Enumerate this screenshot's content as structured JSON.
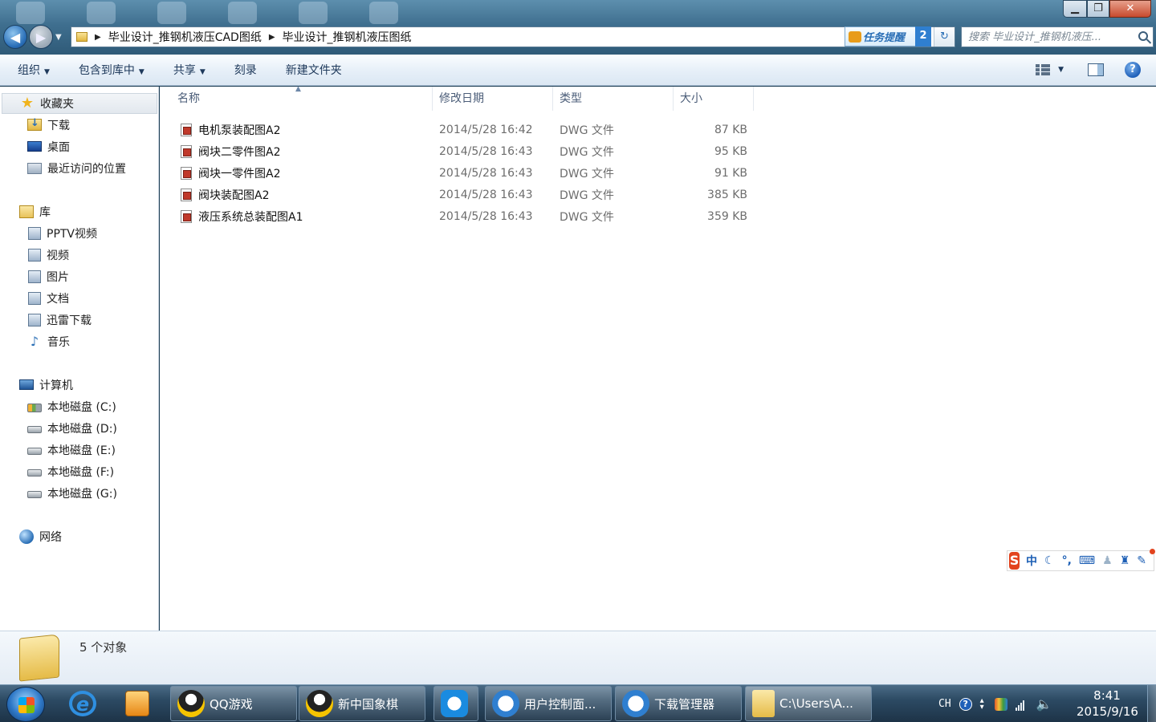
{
  "window": {
    "buttons": {
      "minimize": "▁",
      "maximize": "❐",
      "close": "✕"
    }
  },
  "address": {
    "crumbs": [
      "毕业设计_推钢机液压CAD图纸",
      "毕业设计_推钢机液压图纸"
    ],
    "task_reminder": {
      "label": "任务提醒",
      "count": "2"
    },
    "search_placeholder": "搜索 毕业设计_推钢机液压..."
  },
  "toolbar": {
    "organize": "组织",
    "include_library": "包含到库中",
    "share": "共享",
    "burn": "刻录",
    "new_folder": "新建文件夹"
  },
  "sidebar": {
    "favorites": {
      "label": "收藏夹",
      "items": [
        {
          "label": "下载",
          "icon": "download-folder-icon"
        },
        {
          "label": "桌面",
          "icon": "desktop-icon"
        },
        {
          "label": "最近访问的位置",
          "icon": "recent-places-icon"
        }
      ]
    },
    "libraries": {
      "label": "库",
      "items": [
        {
          "label": "PPTV视频",
          "icon": "library-icon"
        },
        {
          "label": "视频",
          "icon": "video-library-icon"
        },
        {
          "label": "图片",
          "icon": "pictures-library-icon"
        },
        {
          "label": "文档",
          "icon": "documents-library-icon"
        },
        {
          "label": "迅雷下载",
          "icon": "library-icon"
        },
        {
          "label": "音乐",
          "icon": "music-library-icon"
        }
      ]
    },
    "computer": {
      "label": "计算机",
      "items": [
        {
          "label": "本地磁盘 (C:)"
        },
        {
          "label": "本地磁盘 (D:)"
        },
        {
          "label": "本地磁盘 (E:)"
        },
        {
          "label": "本地磁盘 (F:)"
        },
        {
          "label": "本地磁盘 (G:)"
        }
      ]
    },
    "network": {
      "label": "网络"
    }
  },
  "files": {
    "headers": {
      "name": "名称",
      "date": "修改日期",
      "type": "类型",
      "size": "大小"
    },
    "rows": [
      {
        "name": "电机泵装配图A2",
        "date": "2014/5/28 16:42",
        "type": "DWG 文件",
        "size": "87 KB"
      },
      {
        "name": "阀块二零件图A2",
        "date": "2014/5/28 16:43",
        "type": "DWG 文件",
        "size": "95 KB"
      },
      {
        "name": "阀块一零件图A2",
        "date": "2014/5/28 16:43",
        "type": "DWG 文件",
        "size": "91 KB"
      },
      {
        "name": "阀块装配图A2",
        "date": "2014/5/28 16:43",
        "type": "DWG 文件",
        "size": "385 KB"
      },
      {
        "name": "液压系统总装配图A1",
        "date": "2014/5/28 16:43",
        "type": "DWG 文件",
        "size": "359 KB"
      }
    ]
  },
  "ime": {
    "logo": "S",
    "mode": "中"
  },
  "details": {
    "count_text": "5 个对象"
  },
  "taskbar": {
    "tasks": [
      {
        "label": "QQ游戏"
      },
      {
        "label": "新中国象棋"
      },
      {
        "label": "用户控制面..."
      },
      {
        "label": "下载管理器"
      },
      {
        "label": "C:\\Users\\A..."
      }
    ],
    "tray": {
      "lang": "CH"
    },
    "clock": {
      "time": "8:41",
      "date": "2015/9/16"
    }
  },
  "colors": {
    "accent": "#2a6fb6",
    "titlebar": "#3f6f8f",
    "taskbar": "#2c4a63",
    "toolbar_text": "#1e395b",
    "file_meta_text": "#6d6d6d"
  }
}
